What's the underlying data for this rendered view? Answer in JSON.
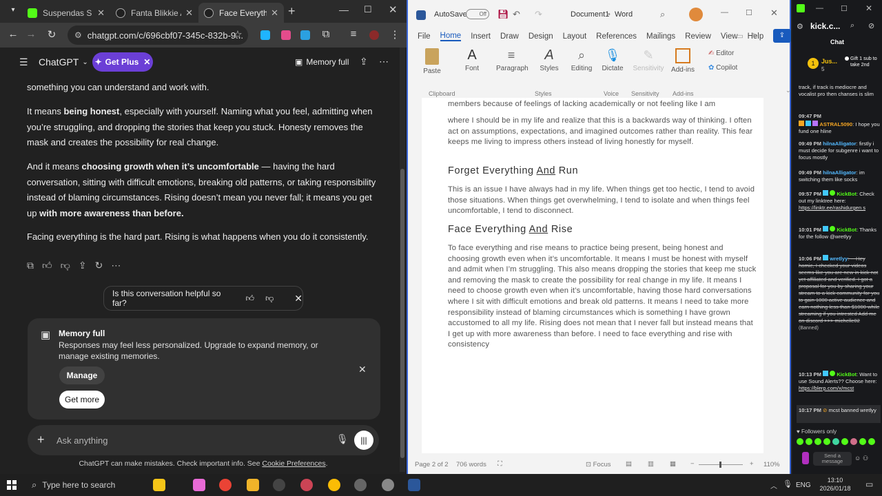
{
  "browser": {
    "tabs": [
      {
        "title": "Suspendas S",
        "color": "#53fc18",
        "active": false
      },
      {
        "title": "Fanta Blikkie Afv",
        "color": "#808080",
        "active": false
      },
      {
        "title": "Face Everything",
        "color": "#808080",
        "active": true
      }
    ],
    "url": "chatgpt.com/c/696cbf07-345c-832b-9..."
  },
  "chatgpt": {
    "brand": "ChatGPT",
    "get_plus": "Get Plus",
    "memory_full": "Memory full",
    "partial_top": "something you can understand and work with.",
    "p1_a": "It means ",
    "p1_b": "being honest",
    "p1_c": ", especially with yourself. Naming what you feel, admitting when you’re struggling, and dropping the stories that keep you stuck. Honesty removes the mask and creates the possibility for real change.",
    "p2_a": "And it means ",
    "p2_b": "choosing growth when it’s uncomfortable",
    "p2_c": " — having the hard conversation, sitting with difficult emotions, breaking old patterns, or taking responsibility instead of blaming circumstances. Rising doesn’t mean you never fall; it means you get up ",
    "p2_d": "with more awareness than before.",
    "p3": "Facing everything is the hard part. Rising is what happens when you do it consistently.",
    "helpful_q": "Is this conversation helpful so far?",
    "memcard_title": "Memory full",
    "memcard_body": "Responses may feel less personalized. Upgrade to expand memory, or manage existing memories.",
    "manage": "Manage",
    "get_more": "Get more",
    "ask_placeholder": "Ask anything",
    "disclaimer": "ChatGPT can make mistakes. Check important info. See ",
    "cookie_link": "Cookie Preferences",
    "disclaimer_end": "."
  },
  "word": {
    "autosave": "AutoSave",
    "autosave_state": "Off",
    "doc_title": "Document1",
    "app": "Word",
    "menu": [
      "File",
      "Home",
      "Insert",
      "Draw",
      "Design",
      "Layout",
      "References",
      "Mailings",
      "Review",
      "View",
      "Help"
    ],
    "ribbon": {
      "paste": "Paste",
      "font": "Font",
      "paragraph": "Paragraph",
      "styles": "Styles",
      "editing": "Editing",
      "dictate": "Dictate",
      "sensitivity": "Sensitivity",
      "addins": "Add-ins",
      "editor": "Editor",
      "copilot": "Copilot",
      "g_clipboard": "Clipboard",
      "g_styles": "Styles",
      "g_voice": "Voice",
      "g_sensitivity": "Sensitivity",
      "g_addins": "Add-ins"
    },
    "doc": {
      "line0": "members because of feelings of lacking academically or not feeling like I am",
      "para1": "where I should be in my life and realize that this is a backwards way of thinking. I often act on assumptions, expectations, and imagined outcomes rather than reality. This fear keeps me living to impress others instead of living honestly for myself.",
      "h1_a": "Forget Everything ",
      "h1_b": "And",
      "h1_c": " Run",
      "para2": "This is an issue I have always had in my life. When things get too hectic, I tend to avoid those situations. When things get overwhelming, I tend to isolate and when things feel uncomfortable, I tend to disconnect.",
      "h2_a": "Face Everything ",
      "h2_b": "And",
      "h2_c": " Rise",
      "para3": "To face everything and rise means to practice being present, being honest and choosing growth even when it’s uncomfortable. It means I must be honest with myself and admit when I’m struggling. This also means dropping the stories that keep me stuck and removing the mask to create the possibility for real change in my life. It means I need to choose growth even when it’s uncomfortable, having those hard conversations where I sit with difficult emotions and break old patterns. It means I need to take more responsibility instead of blaming circumstances which is something I have grown accustomed to all my life. Rising does not mean that I never fall but instead means that I get up with more awareness than before. I need to face everything and rise with consistency"
    },
    "status": {
      "page": "Page 2 of 2",
      "words": "706 words",
      "focus": "Focus",
      "zoom": "110%"
    }
  },
  "kick": {
    "channel": "kick.c...",
    "chat_title": "Chat",
    "pinned_user": "Jus...",
    "pinned_count": "5",
    "pinned_gift": "Gift 1 sub to take 2nd",
    "top_msg": "track, if track is mediocre and vocalist pro then chanses is slim",
    "messages": [
      {
        "time": "09:47 PM",
        "user": "",
        "text": "",
        "color": "#ffffff"
      },
      {
        "time": "",
        "user": "ASTRAL5090",
        "text": ": I hope you fund one hline",
        "color": "#f5a623"
      },
      {
        "time": "09:49 PM",
        "user": "hilnaAlligator",
        "text": ": firstly i must decide for subgenre i want to focus mostly",
        "color": "#53b9ff"
      },
      {
        "time": "09:49 PM",
        "user": "hilnaAlligator",
        "text": ": im switching them like socks",
        "color": "#53b9ff"
      },
      {
        "time": "09:57 PM",
        "user": "KickBot",
        "text": ": Check out my linktree here: ",
        "link": "https://linktr.ee/rashidurgen s",
        "color": "#53fc18"
      },
      {
        "time": "10:01 PM",
        "user": "KickBot",
        "text": ": Thanks for the follow @wretlyy",
        "color": "#53fc18"
      },
      {
        "time": "10:06 PM",
        "user": "wretlyy",
        "text": ": ---Hey homie, I checked your videos seems like you are new in kick not yet affiliated and verified. I got a proposal for you by sharing your stream to a kick community for you to gain 1000 active audience and earn nothing less than $1000 while streaming if you intrested Add me on discord >>> michelle02",
        "deleted": true,
        "banned_tag": "(Banned)",
        "color": "#53b9ff"
      },
      {
        "time": "10:13 PM",
        "user": "KickBot",
        "text": ": Want to use Sound Alerts?? Choose here: ",
        "link": "https://blerp.com/x/mcst",
        "color": "#53fc18"
      },
      {
        "time": "10:17 PM",
        "user": "",
        "text": "mcst banned wretlyy",
        "color": "#ffffff"
      }
    ],
    "followers_only": "Followers only",
    "send": "Send a message"
  },
  "taskbar": {
    "search_placeholder": "Type here to search",
    "lang": "ENG",
    "time": "13:10",
    "date": "2026/01/18"
  }
}
